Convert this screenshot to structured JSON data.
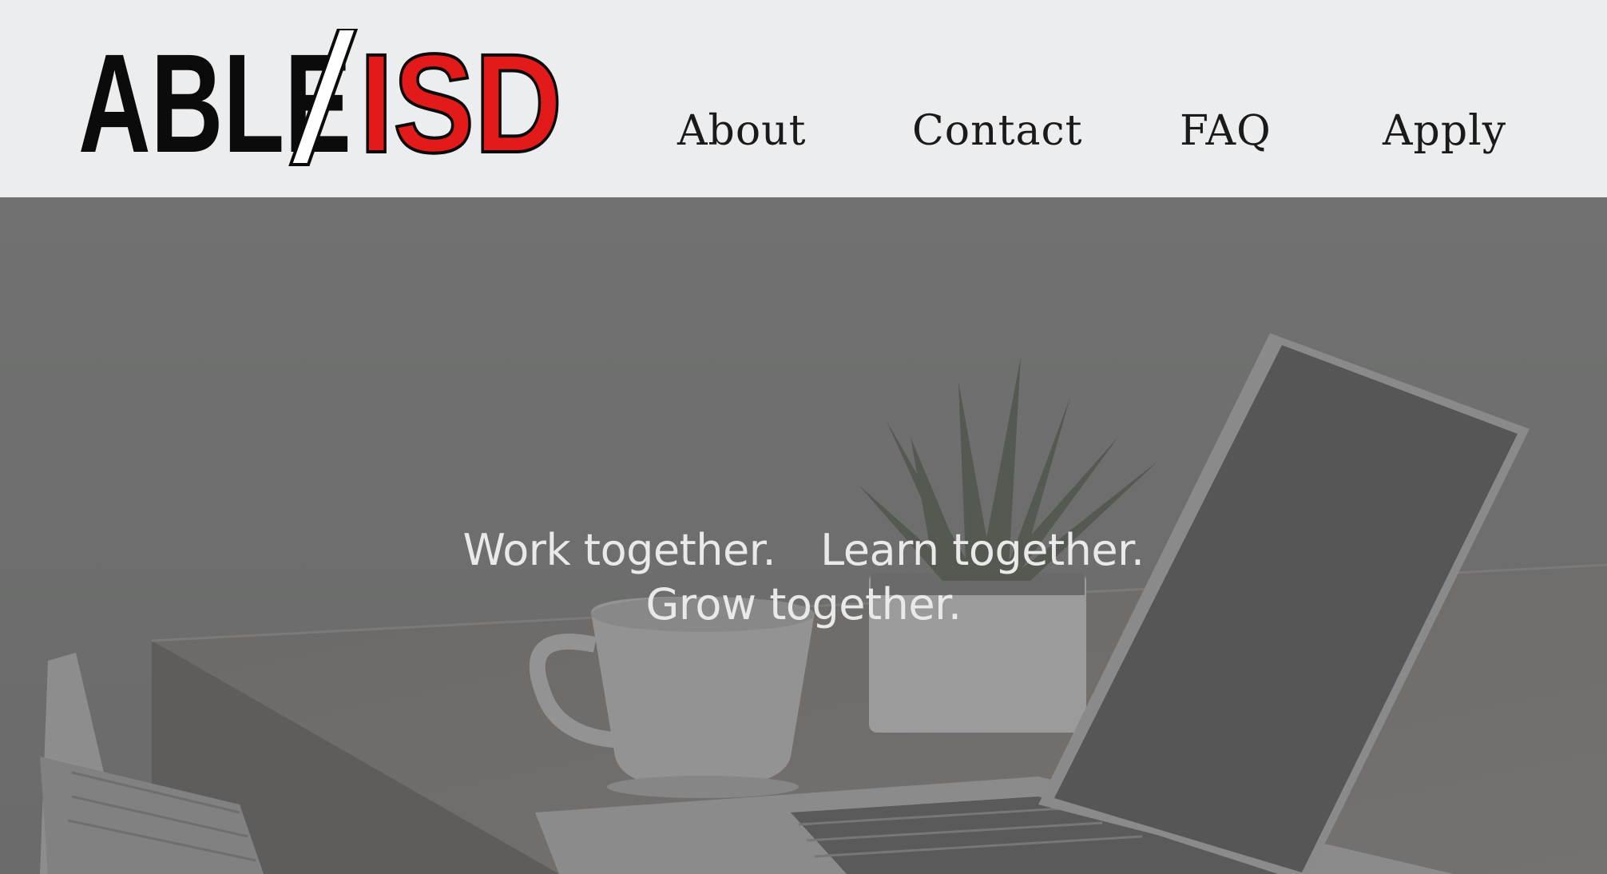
{
  "logo": {
    "left_text": "ABLE",
    "right_text": "ISD",
    "left_color": "#0b0b0b",
    "right_color": "#e21a1a",
    "slash_color": "#ffffff"
  },
  "nav": {
    "items": [
      {
        "label": "About"
      },
      {
        "label": "Contact"
      },
      {
        "label": "FAQ"
      },
      {
        "label": "Apply"
      }
    ]
  },
  "hero": {
    "tagline_1": "Work together.",
    "tagline_2": "Learn together.",
    "tagline_3": "Grow together.",
    "overlay_color": "#6f706f",
    "text_color": "#e9e9e9"
  }
}
